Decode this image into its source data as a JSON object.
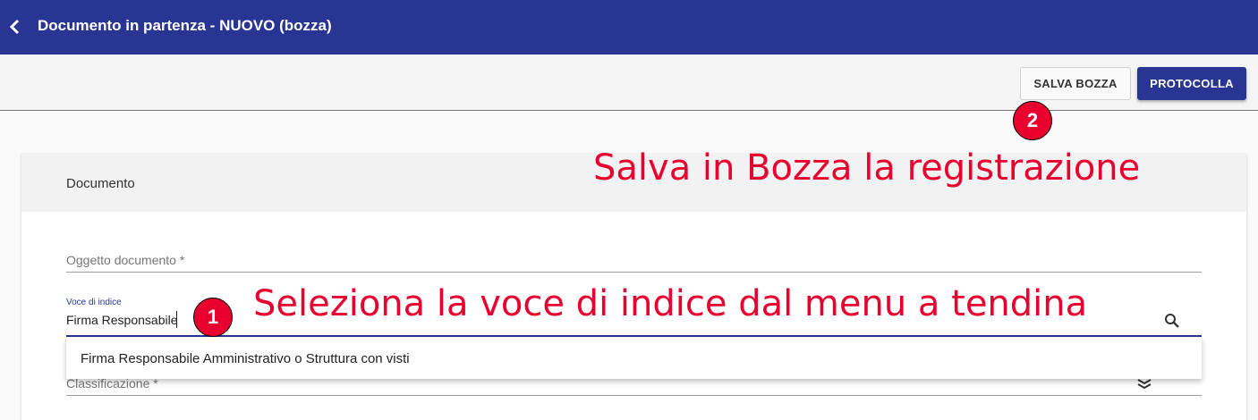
{
  "appbar": {
    "title": "Documento in partenza - NUOVO (bozza)",
    "back_icon": "chevron-left-icon"
  },
  "toolbar": {
    "save_draft_label": "SALVA BOZZA",
    "protocol_label": "PROTOCOLLA"
  },
  "card": {
    "title": "Documento"
  },
  "form": {
    "oggetto": {
      "label": "Oggetto documento *"
    },
    "voce_indice": {
      "label": "Voce di indice",
      "value": "Firma Responsabile",
      "icon": "search-icon"
    },
    "classificazione": {
      "label": "Classificazione *",
      "icon": "stack-icon"
    }
  },
  "dropdown": {
    "options": [
      "Firma Responsabile Amministrativo o Struttura con visti"
    ]
  },
  "annotations": [
    {
      "number": "1",
      "text": "Seleziona la voce di indice dal menu a tendina"
    },
    {
      "number": "2",
      "text": "Salva in Bozza la registrazione"
    }
  ],
  "colors": {
    "primary": "#283593",
    "annotation": "#e8002e"
  }
}
